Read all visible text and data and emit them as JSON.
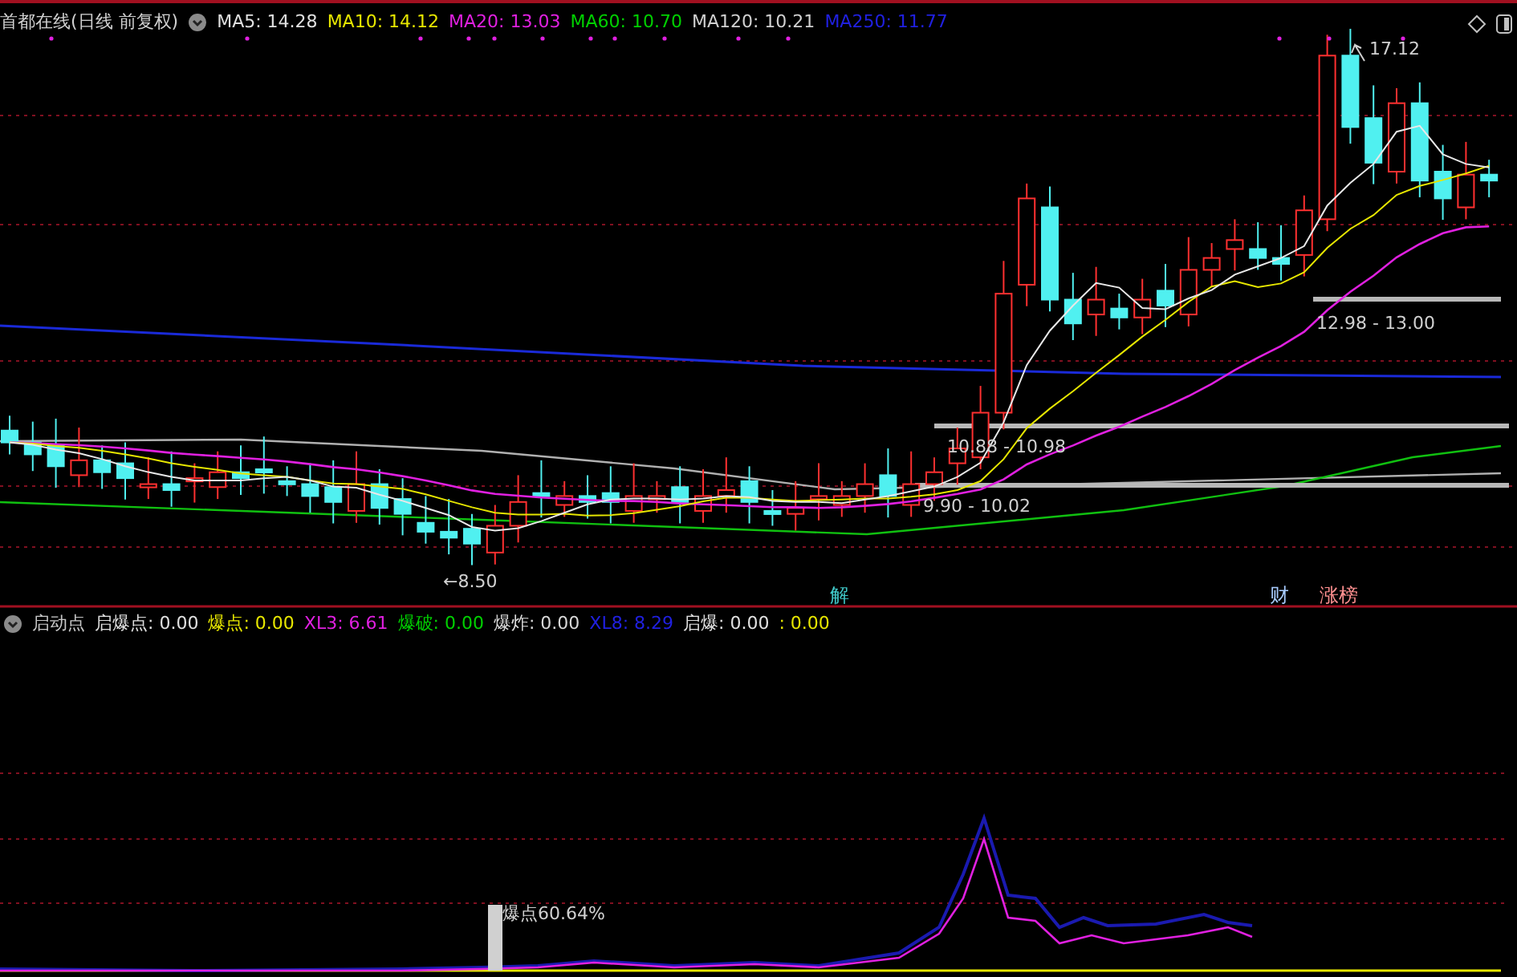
{
  "header": {
    "title": "首都在线(日线 前复权)",
    "indicators": [
      {
        "text": "MA5: 14.28",
        "color": "#e0e0e0"
      },
      {
        "text": "MA10: 14.12",
        "color": "#e6e600"
      },
      {
        "text": "MA20: 13.03",
        "color": "#e020e0"
      },
      {
        "text": "MA60: 10.70",
        "color": "#00d000"
      },
      {
        "text": "MA120: 10.21",
        "color": "#d0d0d0"
      },
      {
        "text": "MA250: 11.77",
        "color": "#2020e0"
      }
    ]
  },
  "price_chart": {
    "annotations": [
      "17.12",
      "12.98 - 13.00",
      "10.88 - 10.98",
      "9.90 - 10.02",
      "←8.50"
    ],
    "event_marks": [
      {
        "text": "解",
        "color": "#40c8c8"
      },
      {
        "text": "财",
        "color": "#a8ccff"
      },
      {
        "text": "涨榜",
        "color": "#ff9090"
      }
    ]
  },
  "indicator_pane": {
    "legend": [
      {
        "text": "启动点",
        "color": "#c8c8c8"
      },
      {
        "text": "启爆点: 0.00",
        "color": "#e0e0e0"
      },
      {
        "text": "爆点: 0.00",
        "color": "#e6e600"
      },
      {
        "text": "XL3: 6.61",
        "color": "#e020e0"
      },
      {
        "text": "爆破: 0.00",
        "color": "#00d000"
      },
      {
        "text": "爆炸: 0.00",
        "color": "#d8d8d8"
      },
      {
        "text": "XL8: 8.29",
        "color": "#2020e0"
      },
      {
        "text": "启爆: 0.00",
        "color": "#e0e0e0"
      },
      {
        "text": ": 0.00",
        "color": "#e6e600"
      }
    ],
    "bar_label": "爆点60.64%"
  }
}
